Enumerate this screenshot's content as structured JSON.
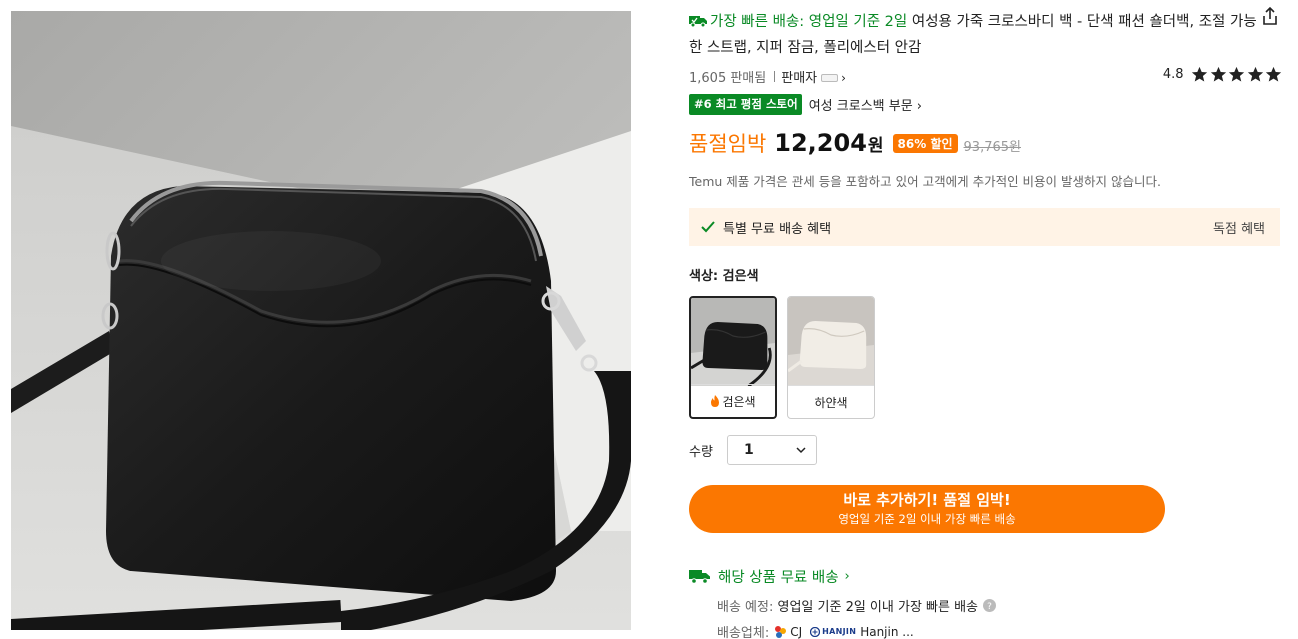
{
  "product": {
    "shipping_tag": "가장 빠른 배송: 영업일 기준 2일",
    "title": "여성용 가죽 크로스바디 백 - 단색 패션 숄더백, 조절 가능한 스트랩, 지퍼 잠금, 폴리에스터 안감",
    "sold_count": "1,605 판매됨",
    "seller_label": "판매자",
    "rating": "4.8",
    "rating_stars": 5,
    "rank_badge": "#6 최고 평점 스토어",
    "rank_category": "여성 크로스백 부문 ›"
  },
  "price": {
    "prefix": "품절임박",
    "current": "12,204",
    "unit": "원",
    "discount": "86% 할인",
    "original": "93,765원",
    "tax_note": "Temu 제품 가격은 관세 등을 포함하고 있어 고객에게 추가적인 비용이 발생하지 않습니다."
  },
  "benefit": {
    "left": "특별 무료 배송 혜택",
    "right": "독점 혜택"
  },
  "color": {
    "label": "색상:",
    "selected": "검은색",
    "options": [
      {
        "label": "검은색",
        "selected": true
      },
      {
        "label": "하얀색",
        "selected": false
      }
    ]
  },
  "quantity": {
    "label": "수량",
    "value": "1"
  },
  "cta": {
    "main": "바로 추가하기! 품절 임박!",
    "sub": "영업일 기준 2일 이내 가장 빠른 배송"
  },
  "shipping": {
    "heading": "해당 상품 무료 배송",
    "eta_label": "배송 예정:",
    "eta_value": "영업일 기준 2일 이내 가장 빠른 배송",
    "carrier_label": "배송업체:",
    "carrier_cj": "CJ",
    "carrier_hanjin_logo": "HANJIN",
    "carrier_hanjin": "Hanjin ..."
  },
  "colors": {
    "accent_orange": "#fb7701",
    "accent_green": "#0a8a25",
    "benefit_bg": "#fff3e6"
  }
}
